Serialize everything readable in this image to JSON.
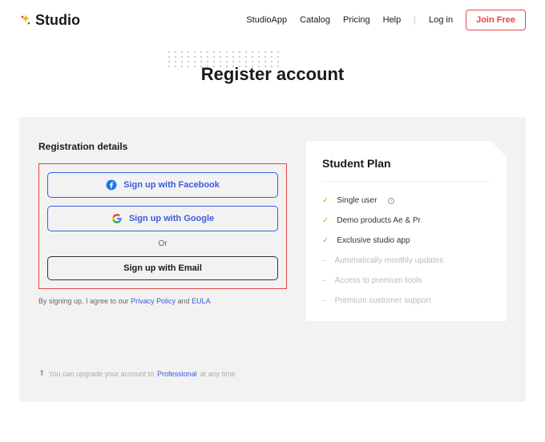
{
  "header": {
    "logo_text": "Studio",
    "nav": {
      "studio_app": "StudioApp",
      "catalog": "Catalog",
      "pricing": "Pricing",
      "help": "Help",
      "login": "Log in",
      "join_free": "Join Free"
    }
  },
  "hero": {
    "title": "Register account"
  },
  "registration": {
    "heading": "Registration details",
    "facebook": "Sign up with Facebook",
    "google": "Sign up with Google",
    "or": "Or",
    "email": "Sign up with Email",
    "consent_pre": "By signing up, I agree to our ",
    "privacy": "Privacy Policy",
    "consent_mid": " and ",
    "eula": "EULA"
  },
  "plan": {
    "title": "Student Plan",
    "features": [
      {
        "label": "Single user",
        "included": true,
        "info": true
      },
      {
        "label": "Demo products Ae & Pr",
        "included": true
      },
      {
        "label": "Exclusive studio app",
        "included": true
      },
      {
        "label": "Automatically monthly updates",
        "included": false
      },
      {
        "label": "Access to premium tools",
        "included": false
      },
      {
        "label": "Premium customer support",
        "included": false
      }
    ]
  },
  "upgrade": {
    "pre": "You can upgrade your account to ",
    "link": "Professional",
    "post": " at any time"
  }
}
